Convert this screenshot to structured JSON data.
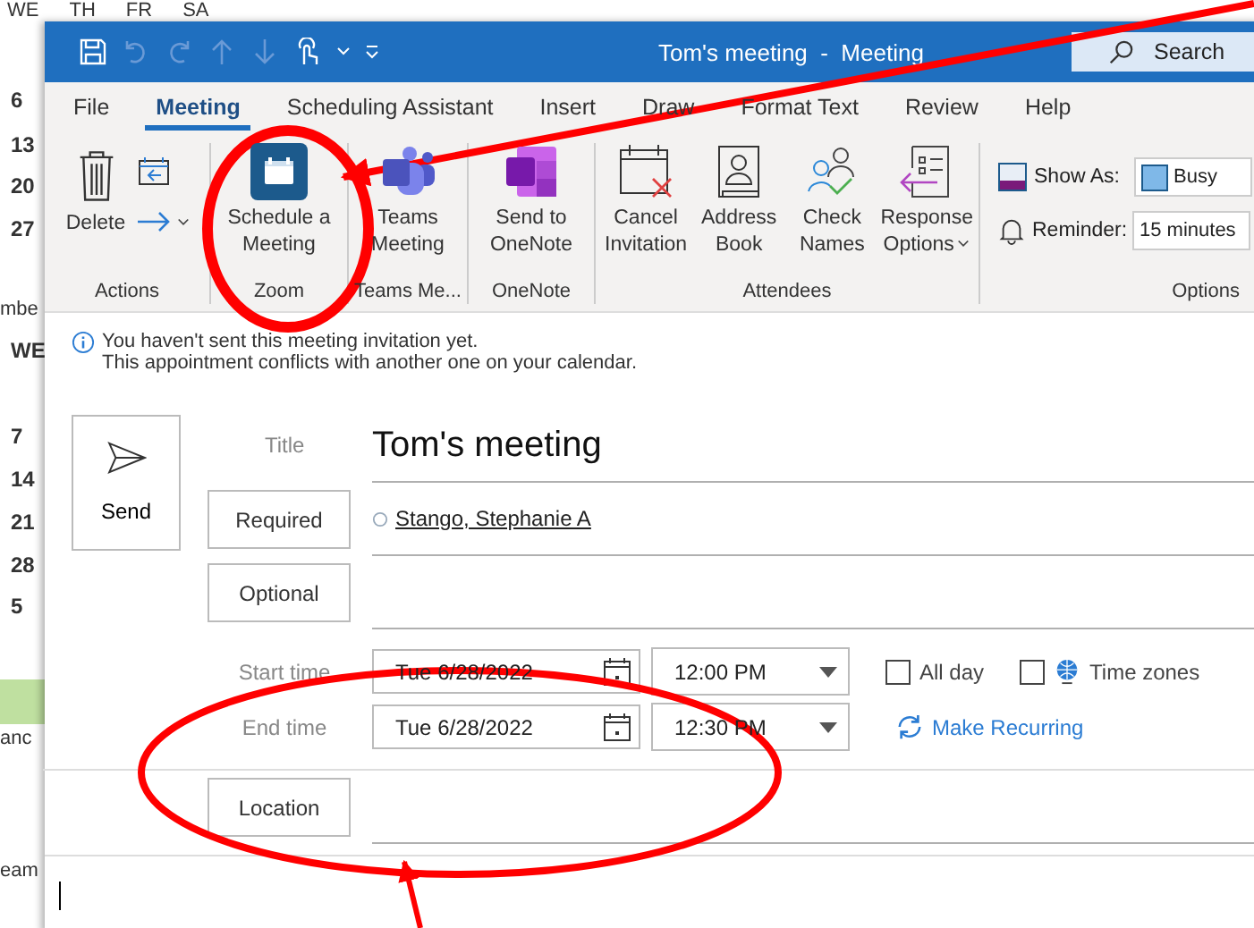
{
  "calendar_behind": {
    "header_days": [
      "WE",
      "TH",
      "FR",
      "SA"
    ],
    "column_texts": [
      "6",
      "13",
      "20",
      "27",
      "mbe",
      "WE",
      "7",
      "14",
      "21",
      "28",
      "5",
      "anc",
      "eam"
    ]
  },
  "window": {
    "title": "Tom's meeting  -  Meeting",
    "search": {
      "placeholder": "Search"
    }
  },
  "tabs": [
    {
      "label": "File",
      "selected": false
    },
    {
      "label": "Meeting",
      "selected": true
    },
    {
      "label": "Scheduling Assistant",
      "selected": false
    },
    {
      "label": "Insert",
      "selected": false
    },
    {
      "label": "Draw",
      "selected": false
    },
    {
      "label": "Format Text",
      "selected": false
    },
    {
      "label": "Review",
      "selected": false
    },
    {
      "label": "Help",
      "selected": false
    }
  ],
  "ribbon": {
    "groups": [
      {
        "label": "Actions",
        "kind": "actions",
        "buttons": [
          {
            "label": "Delete"
          }
        ]
      },
      {
        "label": "Zoom",
        "kind": "large",
        "buttons": [
          {
            "label": "Schedule a Meeting"
          }
        ]
      },
      {
        "label": "Teams Me...",
        "kind": "large",
        "buttons": [
          {
            "label": "Teams Meeting"
          }
        ]
      },
      {
        "label": "OneNote",
        "kind": "large",
        "buttons": [
          {
            "label": "Send to OneNote"
          }
        ]
      },
      {
        "label": "Attendees",
        "kind": "large",
        "buttons": [
          {
            "label": "Cancel Invitation"
          },
          {
            "label": "Address Book"
          },
          {
            "label": "Check Names"
          },
          {
            "label": "Response Options",
            "dropdown": true
          }
        ]
      },
      {
        "label": "Options",
        "kind": "options",
        "show_as": {
          "label": "Show As:",
          "value": "Busy"
        },
        "reminder": {
          "label": "Reminder:",
          "value": "15 minutes"
        }
      }
    ]
  },
  "info": [
    "You haven't sent this meeting invitation yet.",
    "This appointment conflicts with another one on your calendar."
  ],
  "form": {
    "send": "Send",
    "title_label": "Title",
    "title": "Tom's meeting",
    "required": "Required",
    "attendees": [
      "Stango, Stephanie A"
    ],
    "optional": "Optional",
    "start_label": "Start time",
    "start_date": "Tue 6/28/2022",
    "start_time": "12:00 PM",
    "end_label": "End time",
    "end_date": "Tue 6/28/2022",
    "end_time": "12:30 PM",
    "all_day": {
      "label": "All day",
      "checked": false
    },
    "time_zones": {
      "label": "Time zones",
      "checked": false
    },
    "recurring": "Make Recurring",
    "location": "Location"
  }
}
